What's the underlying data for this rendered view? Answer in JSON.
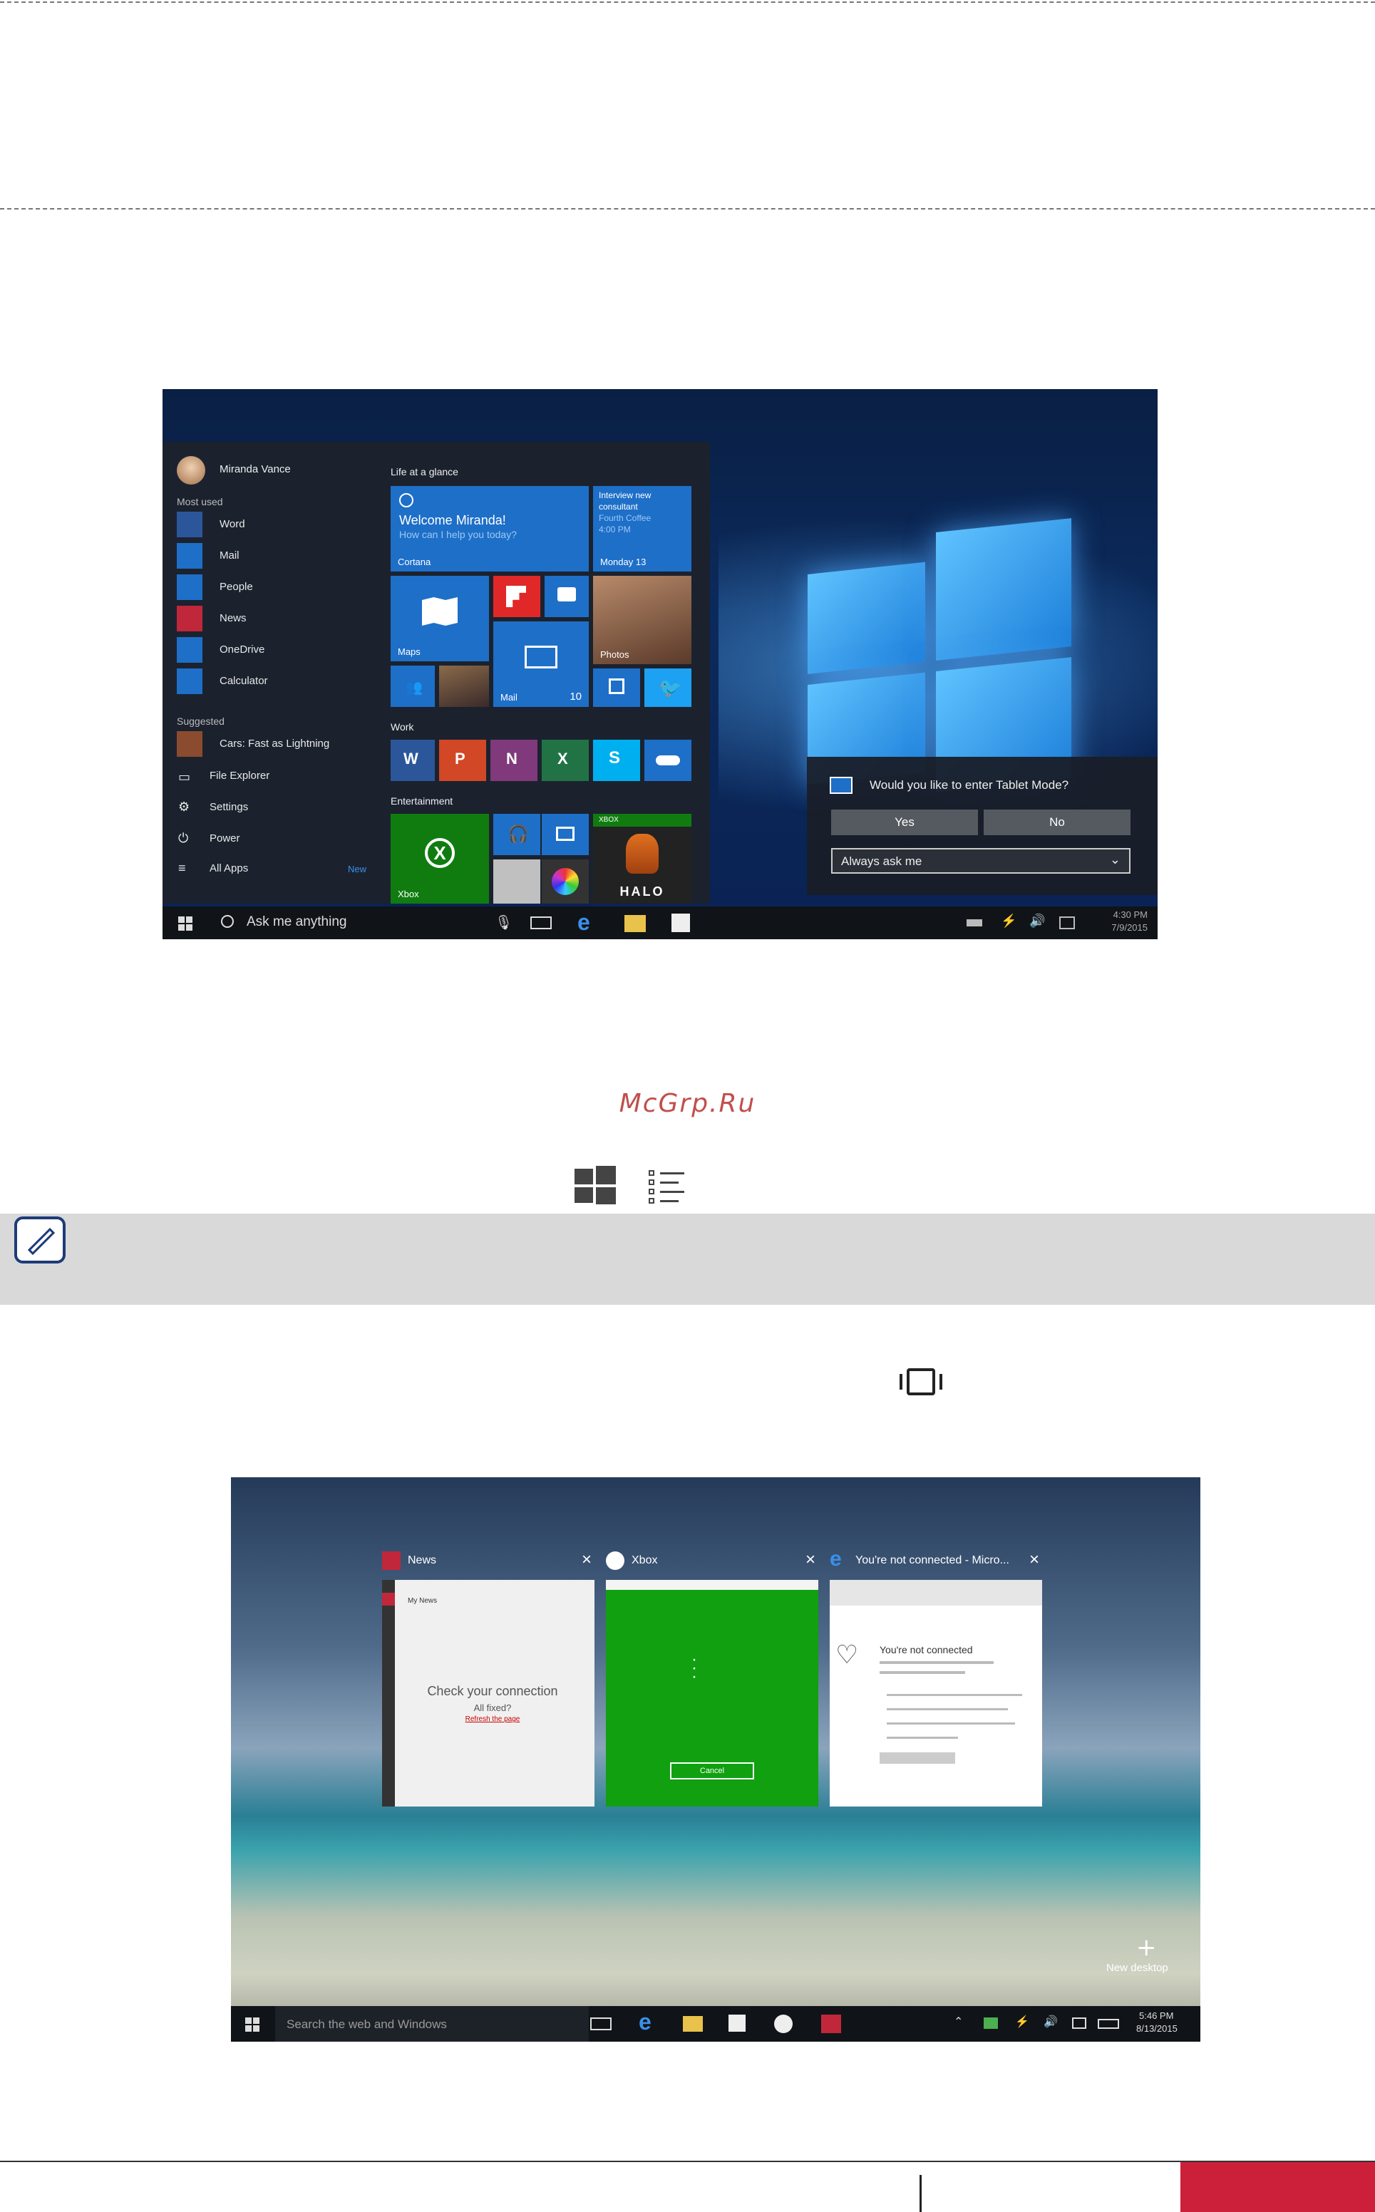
{
  "watermark": "McGrp.Ru",
  "shot1": {
    "user_name": "Miranda Vance",
    "most_used_header": "Most used",
    "most_used": [
      "Word",
      "Mail",
      "People",
      "News",
      "OneDrive",
      "Calculator"
    ],
    "suggested_header": "Suggested",
    "suggested_app": "Cars: Fast as Lightning",
    "system_items": [
      "File Explorer",
      "Settings",
      "Power",
      "All Apps"
    ],
    "all_apps_badge": "New",
    "life_header": "Life at a glance",
    "cortana_welcome": "Welcome Miranda!",
    "cortana_sub": "How can I help you today?",
    "cortana_label": "Cortana",
    "calendar_lines": [
      "Interview new",
      "consultant",
      "Fourth Coffee",
      "4:00 PM"
    ],
    "calendar_date": "Monday 13",
    "maps_label": "Maps",
    "mail_label": "Mail",
    "mail_count": "10",
    "photos_label": "Photos",
    "work_header": "Work",
    "entertainment_header": "Entertainment",
    "xbox_label": "Xbox",
    "xbox_small": "XBOX",
    "halo_label": "HALO",
    "search_placeholder": "Ask me anything",
    "clock_time": "4:30 PM",
    "clock_date": "7/9/2015",
    "tablet_prompt": "Would you like to enter Tablet Mode?",
    "tablet_yes": "Yes",
    "tablet_no": "No",
    "tablet_select": "Always ask me"
  },
  "shot2": {
    "card_titles": [
      "News",
      "Xbox",
      "You're not connected - Micro..."
    ],
    "news_header": "My News",
    "news_message": "Check your connection",
    "news_sub": "All fixed?",
    "news_link": "Refresh the page",
    "xbox_cancel": "Cancel",
    "edge_heading": "You're not connected",
    "new_desktop": "New desktop",
    "search_placeholder": "Search the web and Windows",
    "clock_time": "5:46 PM",
    "clock_date": "8/13/2015"
  },
  "colors": {
    "accent": "#1e6fc8",
    "footer_red": "#cc1f3a",
    "watermark": "#c0504d"
  }
}
